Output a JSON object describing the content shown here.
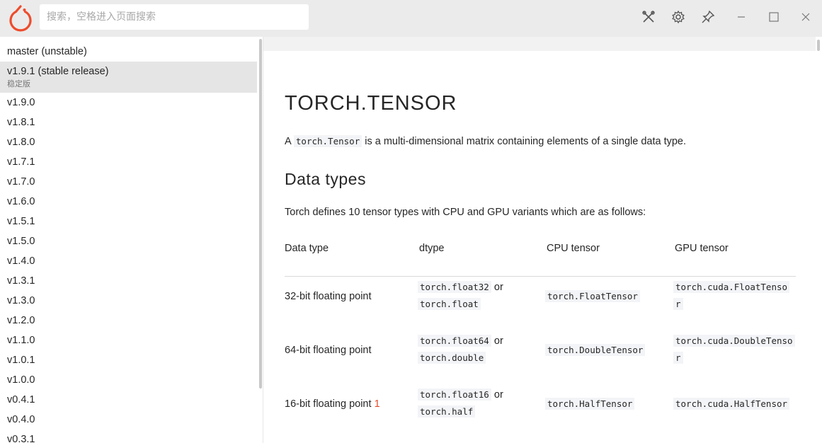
{
  "titlebar": {
    "search_placeholder": "搜索，空格进入页面搜索",
    "icons": [
      "tools-icon",
      "gear-icon",
      "pin-icon",
      "minimize-icon",
      "maximize-icon",
      "close-icon"
    ]
  },
  "sidebar": {
    "versions": [
      {
        "label": "master (unstable)"
      },
      {
        "label": "v1.9.1 (stable release)",
        "sub": "稳定版"
      },
      {
        "label": "v1.9.0"
      },
      {
        "label": "v1.8.1"
      },
      {
        "label": "v1.8.0"
      },
      {
        "label": "v1.7.1"
      },
      {
        "label": "v1.7.0"
      },
      {
        "label": "v1.6.0"
      },
      {
        "label": "v1.5.1"
      },
      {
        "label": "v1.5.0"
      },
      {
        "label": "v1.4.0"
      },
      {
        "label": "v1.3.1"
      },
      {
        "label": "v1.3.0"
      },
      {
        "label": "v1.2.0"
      },
      {
        "label": "v1.1.0"
      },
      {
        "label": "v1.0.1"
      },
      {
        "label": "v1.0.0"
      },
      {
        "label": "v0.4.1"
      },
      {
        "label": "v0.4.0"
      },
      {
        "label": "v0.3.1"
      }
    ]
  },
  "content": {
    "title": "TORCH.TENSOR",
    "intro_prefix": "A",
    "intro_code": "torch.Tensor",
    "intro_suffix": "is a multi-dimensional matrix containing elements of a single data type.",
    "section_title": "Data types",
    "section_desc": "Torch defines 10 tensor types with CPU and GPU variants which are as follows:",
    "table": {
      "headers": [
        "Data type",
        "dtype",
        "CPU tensor",
        "GPU tensor"
      ],
      "rows": [
        {
          "type": "32-bit floating point",
          "footnote": "",
          "dtype1": "torch.float32",
          "or": "or",
          "dtype2": "torch.float",
          "cpu": "torch.FloatTensor",
          "gpu1": "torch.cuda.FloatTenso",
          "gpu2": "r"
        },
        {
          "type": "64-bit floating point",
          "footnote": "",
          "dtype1": "torch.float64",
          "or": "or",
          "dtype2": "torch.double",
          "cpu": "torch.DoubleTensor",
          "gpu1": "torch.cuda.DoubleTenso",
          "gpu2": "r"
        },
        {
          "type": "16-bit floating point",
          "footnote": "1",
          "dtype1": "torch.float16",
          "or": "or",
          "dtype2": "torch.half",
          "cpu": "torch.HalfTensor",
          "gpu1": "torch.cuda.HalfTensor",
          "gpu2": ""
        }
      ]
    }
  },
  "colors": {
    "brand": "#ee4c2c",
    "titlebar_bg": "#ebebeb",
    "selected_bg": "#e5e5e5",
    "footnote": "#e44c2c"
  }
}
